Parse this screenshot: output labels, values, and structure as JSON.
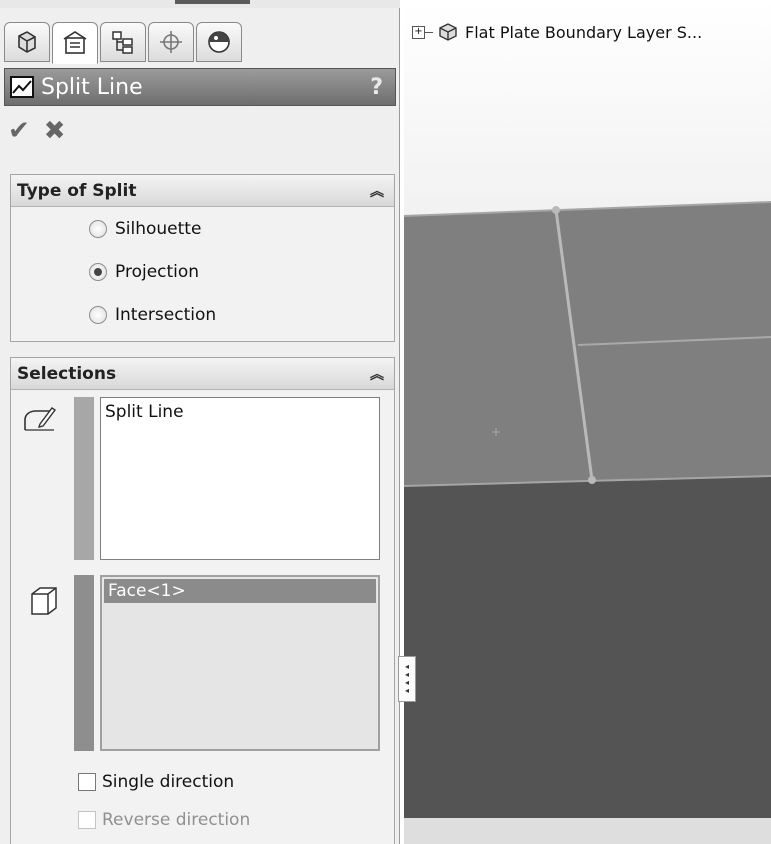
{
  "tabs": [
    {
      "icon": "feature-manager-icon"
    },
    {
      "icon": "property-manager-icon",
      "active": true
    },
    {
      "icon": "configuration-manager-icon"
    },
    {
      "icon": "dimxpert-manager-icon"
    },
    {
      "icon": "display-manager-icon"
    }
  ],
  "header": {
    "title": "Split Line",
    "help": "?"
  },
  "actions": {
    "ok": "✔",
    "cancel": "✖"
  },
  "type_of_split": {
    "title": "Type of Split",
    "options": [
      {
        "label": "Silhouette",
        "selected": false
      },
      {
        "label": "Projection",
        "selected": true
      },
      {
        "label": "Intersection",
        "selected": false
      }
    ]
  },
  "selections": {
    "title": "Selections",
    "sketch_list": [
      "Split Line"
    ],
    "face_list": [
      "Face<1>"
    ],
    "single_direction": "Single direction",
    "reverse_direction": "Reverse direction"
  },
  "viewport": {
    "tree_root": "Flat Plate Boundary Layer S...",
    "colors": {
      "upper_face": "#7f7f7f",
      "lower_face": "#545454",
      "edges": "#b9b9b9"
    }
  }
}
